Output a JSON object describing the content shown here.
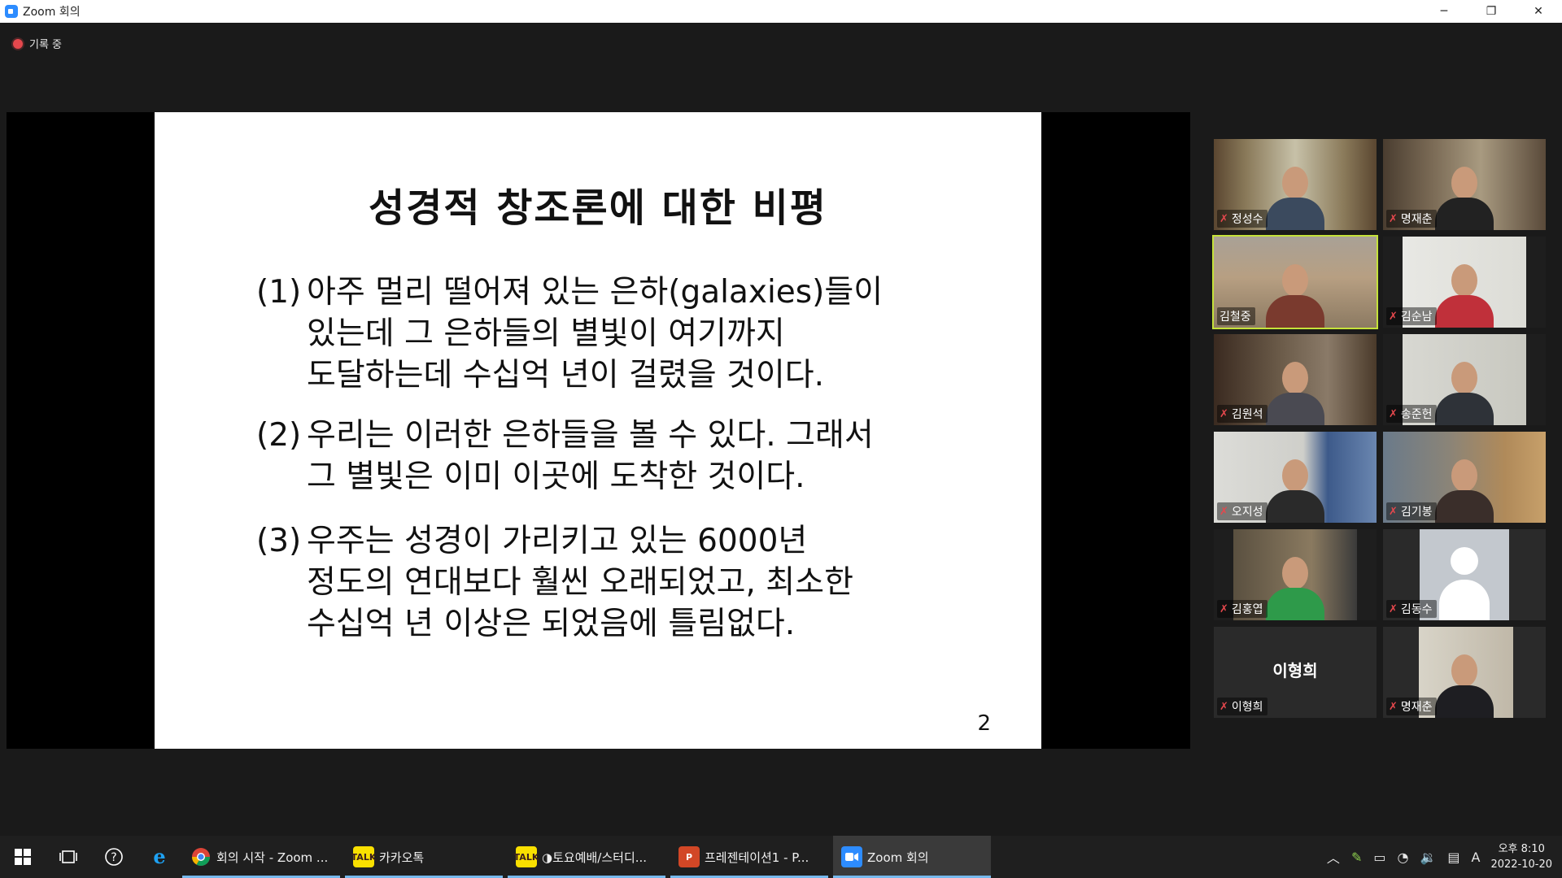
{
  "window": {
    "title": "Zoom 회의",
    "controls": {
      "minimize": "─",
      "restore": "❐",
      "close": "✕"
    }
  },
  "meeting": {
    "recording_label": "기록 중"
  },
  "slide": {
    "title": "성경적 창조론에 대한 비평",
    "items": [
      {
        "num": "(1)",
        "text": "아주 멀리 떨어져 있는 은하(galaxies)들이\n있는데 그 은하들의 별빛이 여기까지\n도달하는데 수십억 년이 걸렸을 것이다."
      },
      {
        "num": "(2)",
        "text": " 우리는 이러한 은하들을 볼 수 있다. 그래서\n그 별빛은 이미 이곳에 도착한 것이다."
      },
      {
        "num": "(3)",
        "text": "우주는 성경이 가리키고 있는 6000년\n정도의 연대보다 훨씬 오래되었고, 최소한\n수십억 년 이상은 되었음에 틀림없다."
      }
    ],
    "page_number": "2"
  },
  "participants": [
    {
      "name": "정성수",
      "muted": true
    },
    {
      "name": "명재춘",
      "muted": true
    },
    {
      "name": "김철중",
      "muted": false,
      "speaking": true
    },
    {
      "name": "김순남",
      "muted": true
    },
    {
      "name": "김원석",
      "muted": true
    },
    {
      "name": "송준헌",
      "muted": true
    },
    {
      "name": "오지성",
      "muted": true
    },
    {
      "name": "김기봉",
      "muted": true
    },
    {
      "name": "김홍엽",
      "muted": true
    },
    {
      "name": "김동수",
      "muted": true,
      "video_off": true
    },
    {
      "name": "이형희",
      "muted": true,
      "video_off": true,
      "display_name": "이형희"
    },
    {
      "name": "명재춘",
      "muted": true
    }
  ],
  "taskbar": {
    "apps": [
      {
        "label": "회의 시작 - Zoom ...",
        "icon": "chrome-icon"
      },
      {
        "label": "카카오톡",
        "icon": "kakaotalk-icon"
      },
      {
        "label": "◑토요예배/스터디...",
        "icon": "kakaotalk-icon"
      },
      {
        "label": "프레젠테이션1 - P...",
        "icon": "powerpoint-icon"
      },
      {
        "label": "Zoom 회의",
        "icon": "zoom-icon"
      }
    ],
    "tray": {
      "ime": "A",
      "time": "오후 8:10",
      "date": "2022-10-20"
    }
  },
  "colors": {
    "active_speaker_border": "#c5e23a",
    "recording_dot": "#e5484d",
    "mic_muted": "#e5484d",
    "taskbar_indicator": "#76b9ed"
  }
}
